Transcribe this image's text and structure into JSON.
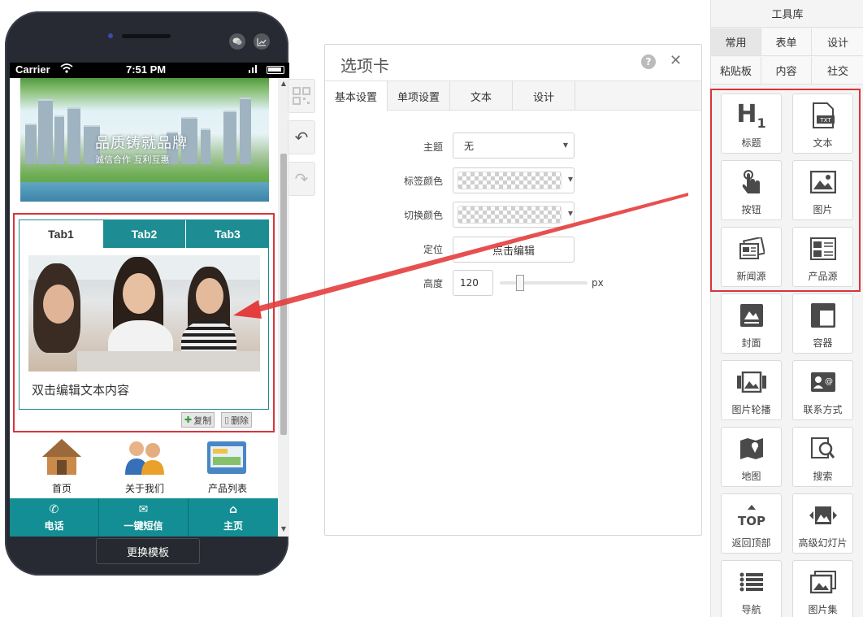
{
  "phone": {
    "status": {
      "carrier": "Carrier",
      "time": "7:51 PM"
    },
    "banner": {
      "slogan": "品质铸就品牌",
      "subslogan": "诚信合作 互利互惠"
    },
    "tabs": [
      {
        "label": "Tab1",
        "active": true
      },
      {
        "label": "Tab2",
        "active": false
      },
      {
        "label": "Tab3",
        "active": false
      }
    ],
    "tab_text": "双击编辑文本内容",
    "copy_label": "复制",
    "delete_label": "删除",
    "nav": [
      {
        "label": "首页",
        "icon": "house-icon"
      },
      {
        "label": "关于我们",
        "icon": "people-icon"
      },
      {
        "label": "产品列表",
        "icon": "product-icon"
      }
    ],
    "bottom": [
      {
        "label": "电话",
        "icon": "phone-icon"
      },
      {
        "label": "一键短信",
        "icon": "message-icon"
      },
      {
        "label": "主页",
        "icon": "home-icon"
      }
    ],
    "change_template": "更换模板"
  },
  "dialog": {
    "title": "选项卡",
    "tabs": [
      {
        "label": "基本设置",
        "active": true
      },
      {
        "label": "单项设置",
        "active": false
      },
      {
        "label": "文本",
        "active": false
      },
      {
        "label": "设计",
        "active": false
      }
    ],
    "fields": {
      "theme": {
        "label": "主题",
        "value": "无"
      },
      "tab_color": {
        "label": "标签颜色"
      },
      "switch_color": {
        "label": "切换颜色"
      },
      "position": {
        "label": "定位",
        "button": "点击编辑"
      },
      "height": {
        "label": "高度",
        "value": "120",
        "unit": "px"
      }
    }
  },
  "toolbox": {
    "title": "工具库",
    "tabs_row1": [
      {
        "label": "常用",
        "active": true
      },
      {
        "label": "表单",
        "active": false
      },
      {
        "label": "设计",
        "active": false
      }
    ],
    "tabs_row2": [
      {
        "label": "粘贴板"
      },
      {
        "label": "内容"
      },
      {
        "label": "社交"
      }
    ],
    "tools": [
      {
        "label": "标题",
        "icon": "heading-icon"
      },
      {
        "label": "文本",
        "icon": "text-file-icon"
      },
      {
        "label": "按钮",
        "icon": "finger-tap-icon"
      },
      {
        "label": "图片",
        "icon": "image-icon"
      },
      {
        "label": "新闻源",
        "icon": "newspaper-icon"
      },
      {
        "label": "产品源",
        "icon": "product-list-icon"
      },
      {
        "label": "封面",
        "icon": "cover-icon"
      },
      {
        "label": "容器",
        "icon": "container-icon"
      },
      {
        "label": "图片轮播",
        "icon": "carousel-icon"
      },
      {
        "label": "联系方式",
        "icon": "contact-card-icon"
      },
      {
        "label": "地图",
        "icon": "map-icon"
      },
      {
        "label": "搜索",
        "icon": "search-icon"
      },
      {
        "label": "返回顶部",
        "icon": "back-to-top-icon"
      },
      {
        "label": "高级幻灯片",
        "icon": "slideshow-icon"
      },
      {
        "label": "导航",
        "icon": "nav-list-icon"
      },
      {
        "label": "图片集",
        "icon": "gallery-icon"
      }
    ]
  },
  "colors": {
    "accent_teal": "#1e8d93",
    "highlight_red": "#d9343a"
  }
}
